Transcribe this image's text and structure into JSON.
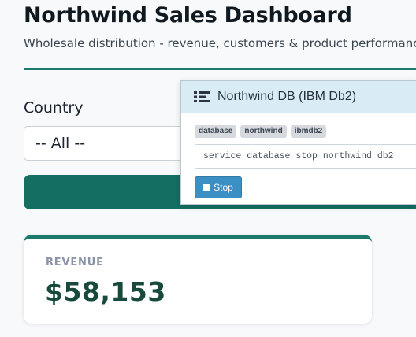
{
  "header": {
    "title": "Northwind Sales Dashboard",
    "subtitle": "Wholesale distribution - revenue, customers & product performance"
  },
  "filters": {
    "country_label": "Country",
    "country_selected": "-- All --"
  },
  "kpi": {
    "label": "REVENUE",
    "value": "$58,153"
  },
  "panel": {
    "title": "Northwind DB (IBM Db2)",
    "tags": [
      "database",
      "northwind",
      "ibmdb2"
    ],
    "command": "service database stop northwind db2",
    "stop_label": "Stop",
    "icon": "list-icon"
  },
  "colors": {
    "accent": "#1b7a6b",
    "button": "#146e61",
    "value": "#174a3c",
    "stop": "#3b8fc2"
  }
}
